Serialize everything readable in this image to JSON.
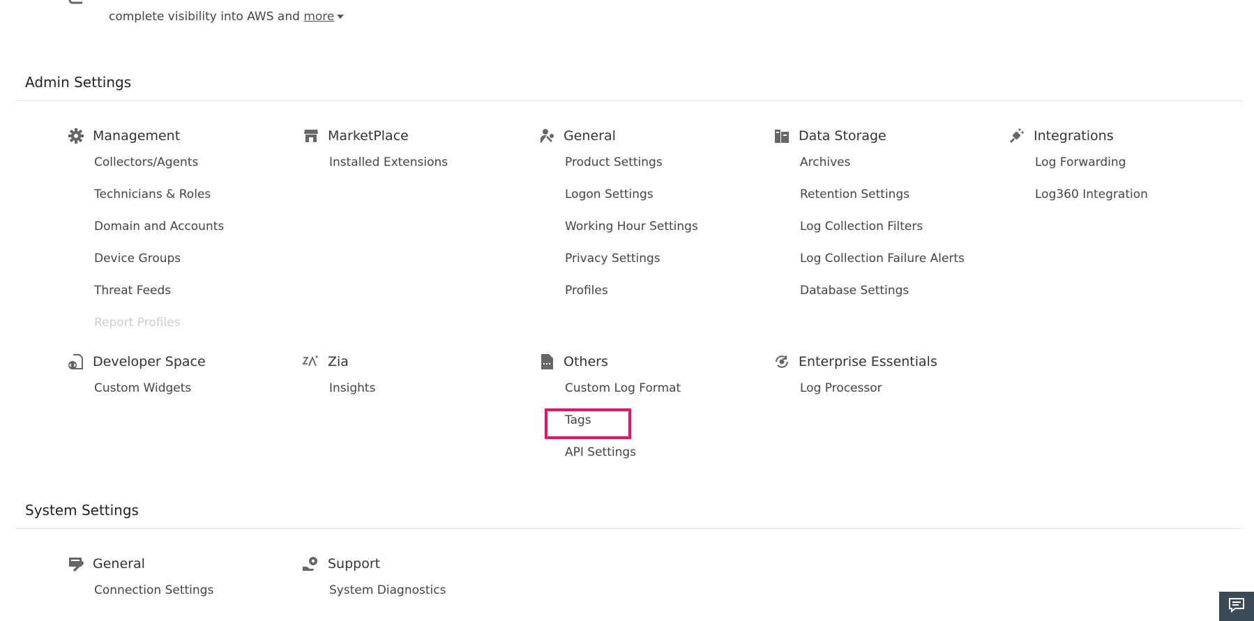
{
  "top": {
    "desc": "complete visibility into AWS and",
    "more": "more"
  },
  "admin": {
    "title": "Admin Settings",
    "categories": [
      {
        "title": "Management",
        "items": [
          "Collectors/Agents",
          "Technicians & Roles",
          "Domain and Accounts",
          "Device Groups",
          "Threat Feeds",
          "Report Profiles"
        ]
      },
      {
        "title": "MarketPlace",
        "items": [
          "Installed Extensions"
        ]
      },
      {
        "title": "General",
        "items": [
          "Product Settings",
          "Logon Settings",
          "Working Hour Settings",
          "Privacy Settings",
          "Profiles"
        ]
      },
      {
        "title": "Data Storage",
        "items": [
          "Archives",
          "Retention Settings",
          "Log Collection Filters",
          "Log Collection Failure Alerts",
          "Database Settings"
        ]
      },
      {
        "title": "Integrations",
        "items": [
          "Log Forwarding",
          "Log360 Integration"
        ]
      },
      {
        "title": "Developer Space",
        "items": [
          "Custom Widgets"
        ]
      },
      {
        "title": "Zia",
        "items": [
          "Insights"
        ]
      },
      {
        "title": "Others",
        "items": [
          "Custom Log Format",
          "Tags",
          "API Settings"
        ]
      },
      {
        "title": "Enterprise Essentials",
        "items": [
          "Log Processor"
        ]
      }
    ]
  },
  "system": {
    "title": "System Settings",
    "categories": [
      {
        "title": "General",
        "items": [
          "Connection Settings"
        ]
      },
      {
        "title": "Support",
        "items": [
          "System Diagnostics"
        ]
      }
    ]
  },
  "colors": {
    "highlight": "#ec1262",
    "chat_bg": "#3a4a57"
  }
}
